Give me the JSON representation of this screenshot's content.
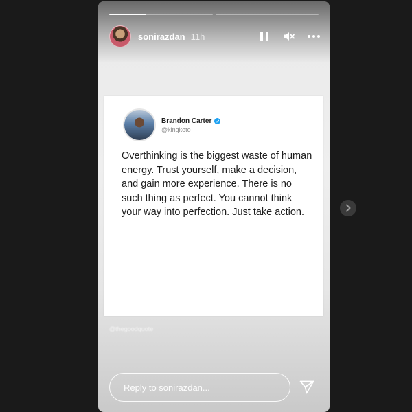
{
  "story": {
    "progress": [
      {
        "fill": 0.35
      },
      {
        "fill": 0.0
      }
    ],
    "header": {
      "username": "sonirazdan",
      "time": "11h",
      "avatar_icon": "profile-avatar",
      "pause_icon": "pause-icon",
      "mute_icon": "mute-icon",
      "more_icon": "more-options-icon"
    },
    "tweet": {
      "name": "Brandon Carter",
      "handle": "@kingketo",
      "verified_color": "#1da1f2",
      "text": "Overthinking is the biggest waste of human energy. Trust yourself, make a decision, and gain more experience. There is no such thing as perfect. You cannot think your way into perfection. Just take action."
    },
    "watermark": "@thegoodquote",
    "reply": {
      "placeholder": "Reply to sonirazdan...",
      "send_icon": "send-icon"
    }
  },
  "navigation": {
    "next_icon": "chevron-right-icon"
  },
  "colors": {
    "background": "#1a1a1a",
    "card": "#ffffff",
    "text": "#1d1d1d"
  }
}
